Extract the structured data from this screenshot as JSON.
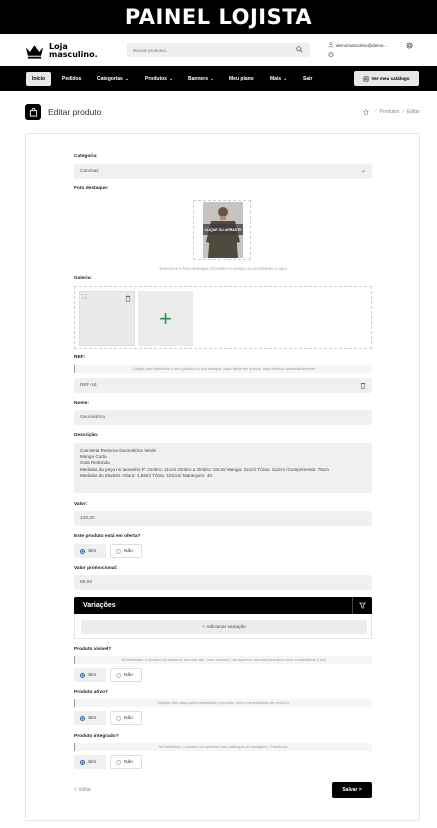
{
  "banner": {
    "title": "PAINEL LOJISTA"
  },
  "header": {
    "logo_line1": "Loja",
    "logo_line2": "masculino.",
    "search_placeholder": "Buscar produtos...",
    "user_email": "demomasculino@demo..."
  },
  "nav": {
    "items": [
      {
        "label": "Início",
        "dropdown": false,
        "active": true
      },
      {
        "label": "Pedidos",
        "dropdown": false
      },
      {
        "label": "Categorias",
        "dropdown": true
      },
      {
        "label": "Produtos",
        "dropdown": true
      },
      {
        "label": "Banners",
        "dropdown": true
      },
      {
        "label": "Meu plano",
        "dropdown": false
      },
      {
        "label": "Mais",
        "dropdown": true
      },
      {
        "label": "Sair",
        "dropdown": false
      }
    ],
    "catalog_button": "Ver meu catálogo"
  },
  "page": {
    "title": "Editar produto",
    "breadcrumb": [
      "Produtos",
      "Editar"
    ]
  },
  "form": {
    "category_label": "Categoria:",
    "category_value": "Camisas",
    "featured_photo_label": "Foto destaque:",
    "photo_overlay": "CLIQUE OU ARRASTE",
    "photo_hint": "Selecione a foto destaque clicando no campo ou arrastando-a aqui",
    "gallery_label": "Galeria:",
    "gallery_add": "+",
    "ref_label": "REF:",
    "ref_hint": "Código para identificar o seu produto no seu estoque, caso deixe em branco, será definido automaticamente",
    "ref_value": "REF-18",
    "name_label": "Nome:",
    "name_value": "Geométrica",
    "description_label": "Descrição:",
    "description_value": "Camiseta Reserva Geométrica Verde\nManga Curta\nGola Redonda\nMedidas da peça no tamanho P: Ombro: 11cm/ Ombro a Ombro: 54cm/ Manga: 22cm/ Tórax: 112cm /Comprimento: 76cm\nMedidas do Modelo: Altura: 1,86m/ Tórax: 101cm/ Manequim: 40.",
    "price_label": "Valor:",
    "price_value": "120,00",
    "on_sale_label": "Este produto está em oferta?",
    "on_sale_yes": "Sim",
    "on_sale_no": "Não",
    "promo_price_label": "Valor promocional:",
    "promo_price_value": "89,00",
    "variations_title": "Variações",
    "add_variation": "+ Adicionar variação",
    "visible_label": "Produto visível?",
    "visible_hint": "Se habilitado, o produto irá aparecer em todo site, caso contrário, irá aparecer apenas para quem tiver compartilhar o link",
    "visible_yes": "Sim",
    "visible_no": "Não",
    "active_label": "Produto ativo?",
    "active_hint": "Marque não caso queira desabilitar o produto, sem a necessidade de excluí-lo",
    "active_yes": "Sim",
    "active_no": "Não",
    "integrated_label": "Produto integrado?",
    "integrated_hint": "Se habilitado, o produto irá aparecer nos catálogos do Instagram / Facebook.",
    "integrated_yes": "Sim",
    "integrated_no": "Não",
    "back_label": "< Voltar",
    "save_label": "Salvar >"
  },
  "colors": {
    "accent": "#000000",
    "add_green": "#1a9a4a",
    "radio_blue": "#1b66c9"
  }
}
